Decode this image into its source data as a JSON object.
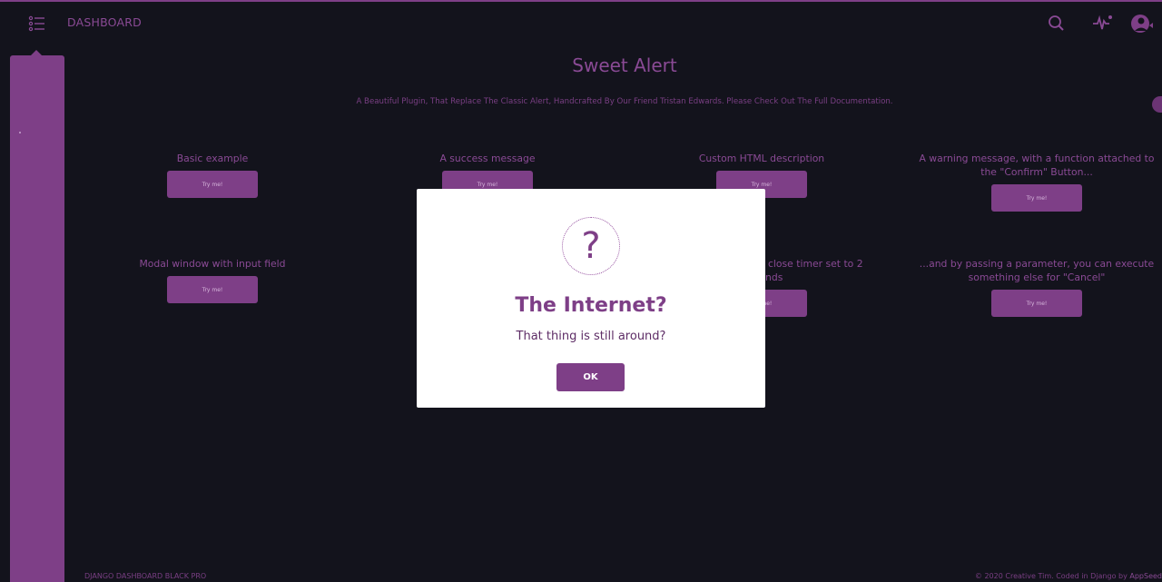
{
  "navbar": {
    "brand": "DASHBOARD",
    "toggle_icon": "list-menu-icon",
    "search_icon": "search-icon",
    "activity_icon": "activity-icon",
    "avatar_icon": "avatar"
  },
  "page": {
    "title": "Sweet Alert",
    "description": "A Beautiful Plugin, That Replace The Classic Alert, Handcrafted By Our Friend Tristan Edwards. Please Check Out The Full Documentation."
  },
  "demos": [
    {
      "label": "Basic example",
      "button": "Try me!"
    },
    {
      "label": "A success message",
      "button": "Try me!"
    },
    {
      "label": "Custom HTML description",
      "button": "Try me!"
    },
    {
      "label": "A warning message, with a function attached to the \"Confirm\" Button...",
      "button": "Try me!"
    },
    {
      "label": "Modal window with input field",
      "button": "Try me!"
    },
    {
      "label": "close timer set to 2",
      "label2": "nds",
      "button": "Try me!"
    },
    {
      "label": "...and by passing a parameter, you can execute something else for \"Cancel\"",
      "button": "Try me!"
    }
  ],
  "modal": {
    "icon": "question-icon",
    "icon_glyph": "?",
    "title": "The Internet?",
    "text": "That thing is still around?",
    "ok_label": "OK"
  },
  "footer": {
    "left": "DJANGO DASHBOARD BLACK PRO",
    "right_prefix": "© 2020 Creative Tim. Coded in Django by ",
    "right_brand": "AppSeed"
  },
  "colors": {
    "accent": "#7e3f87",
    "background": "#13131c",
    "modal_bg": "#ffffff"
  }
}
